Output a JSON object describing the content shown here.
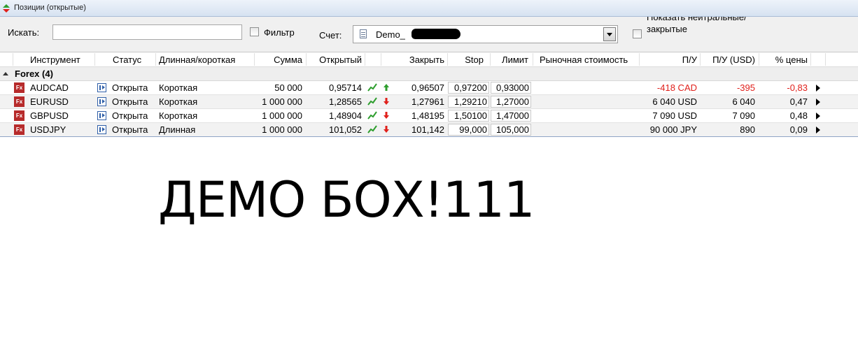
{
  "window": {
    "title": "Позиции (открытые)"
  },
  "toolbar": {
    "search_label": "Искать:",
    "search_value": "",
    "filter_label": "Фильтр",
    "account_label": "Счет:",
    "account_value": "Demo_",
    "neutral_label": "Показать нейтральные/закрытые"
  },
  "columns": {
    "instrument": "Инструмент",
    "status": "Статус",
    "long_short": "Длинная/короткая",
    "amount": "Сумма",
    "open": "Открытый",
    "close": "Закрыть",
    "stop": "Stop",
    "limit": "Лимит",
    "market_value": "Рыночная стоимость",
    "pl": "П/У",
    "pl_usd": "П/У (USD)",
    "price_pct": "% цены"
  },
  "group": {
    "label": "Forex  (4)"
  },
  "rows": [
    {
      "icon": "Fx",
      "instrument": "AUDCAD",
      "status": "Открыта",
      "side": "Короткая",
      "amount": "50 000",
      "open": "0,95714",
      "direction": "up",
      "close": "0,96507",
      "stop": "0,97200",
      "limit": "0,93000",
      "market_value": "",
      "pl": "-418 CAD",
      "pl_usd": "-395",
      "price_pct": "-0,83",
      "negative": true
    },
    {
      "icon": "Fx",
      "instrument": "EURUSD",
      "status": "Открыта",
      "side": "Короткая",
      "amount": "1 000 000",
      "open": "1,28565",
      "direction": "down",
      "close": "1,27961",
      "stop": "1,29210",
      "limit": "1,27000",
      "market_value": "",
      "pl": "6 040 USD",
      "pl_usd": "6 040",
      "price_pct": "0,47",
      "negative": false
    },
    {
      "icon": "Fx",
      "instrument": "GBPUSD",
      "status": "Открыта",
      "side": "Короткая",
      "amount": "1 000 000",
      "open": "1,48904",
      "direction": "down",
      "close": "1,48195",
      "stop": "1,50100",
      "limit": "1,47000",
      "market_value": "",
      "pl": "7 090 USD",
      "pl_usd": "7 090",
      "price_pct": "0,48",
      "negative": false
    },
    {
      "icon": "Fx",
      "instrument": "USDJPY",
      "status": "Открыта",
      "side": "Длинная",
      "amount": "1 000 000",
      "open": "101,052",
      "direction": "down",
      "close": "101,142",
      "stop": "99,000",
      "limit": "105,000",
      "market_value": "",
      "pl": "90 000 JPY",
      "pl_usd": "890",
      "price_pct": "0,09",
      "negative": false
    }
  ],
  "overlay_text": "ДЕМО БОХ!111",
  "colors": {
    "negative": "#e0201b",
    "trend": "#2e9e2e",
    "arrow_down": "#e0201b",
    "arrow_up": "#2e9e2e"
  }
}
